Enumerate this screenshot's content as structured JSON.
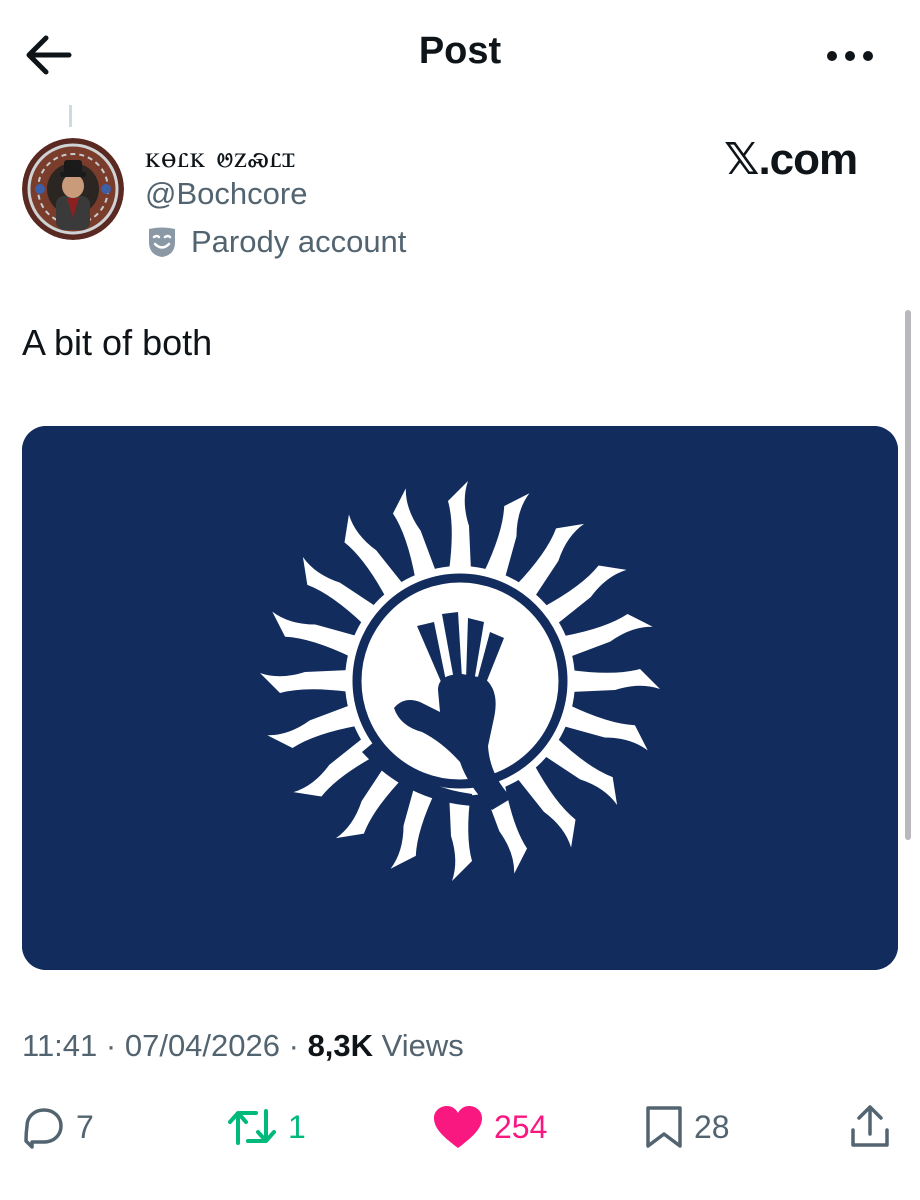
{
  "header": {
    "title": "Post"
  },
  "author": {
    "display_name": "ꮶꮎꮭꮶ ꮼꮓꮝꮭꮖ",
    "handle": "@Bochcore",
    "label": "Parody account"
  },
  "brand": {
    "text": "𝕏.com"
  },
  "post": {
    "text": "A bit of both",
    "image_colors": {
      "background": "#112c5d",
      "symbol": "#ffffff"
    }
  },
  "meta": {
    "time": "11:41",
    "separator": " · ",
    "date": "07/04/2026",
    "views_count": "8,3K",
    "views_label": "Views"
  },
  "actions": {
    "replies": "7",
    "reposts": "1",
    "likes": "254",
    "bookmarks": "28"
  },
  "colors": {
    "text": "#0f1419",
    "secondary": "#536471",
    "repost": "#00ba7c",
    "like": "#f91880"
  }
}
